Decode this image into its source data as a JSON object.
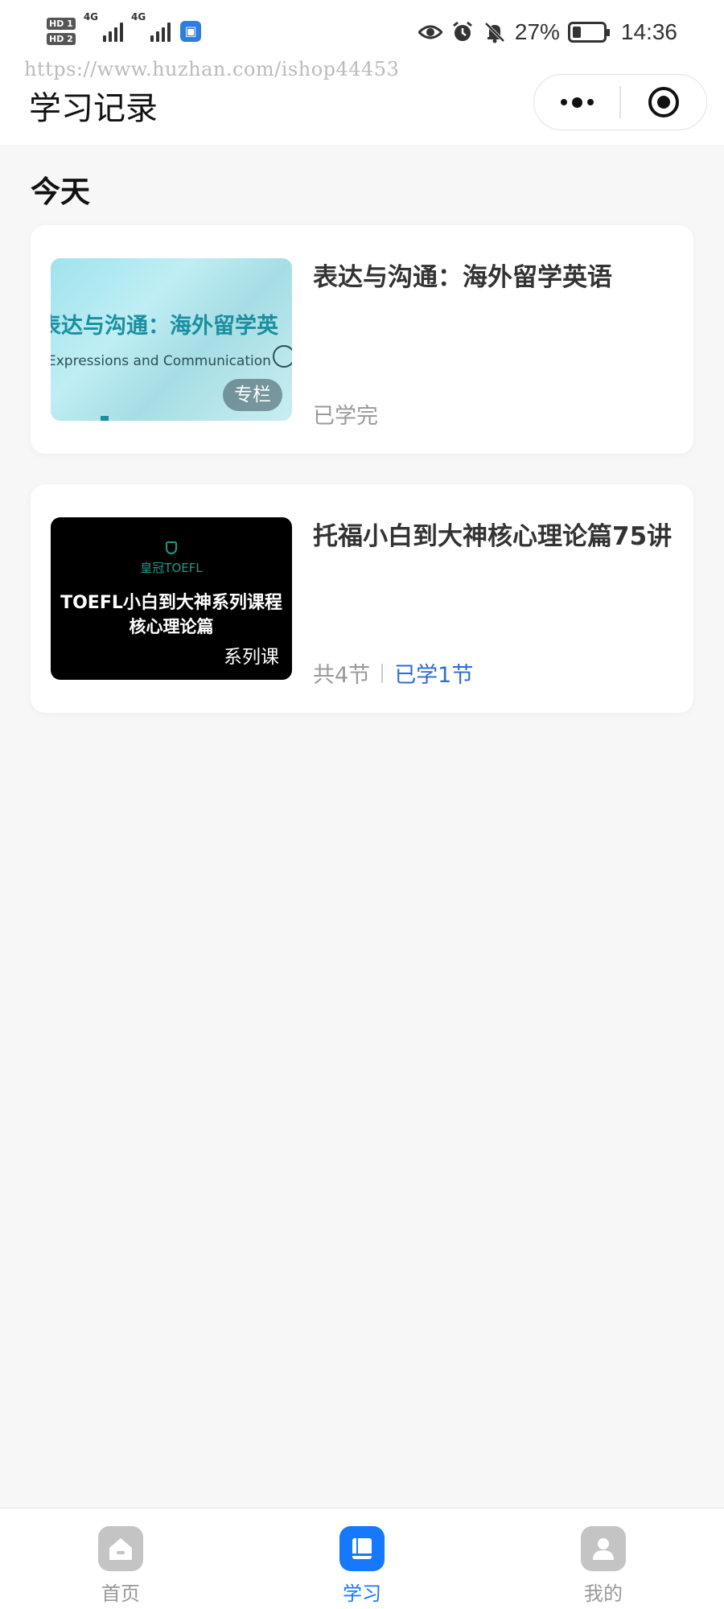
{
  "status_bar": {
    "sim1": "HD 1",
    "sim2": "HD 2",
    "net1": "4G",
    "net2": "4G",
    "battery_percent": "27%",
    "battery_level": 0.27,
    "time": "14:36",
    "icons": [
      "eye-icon",
      "alarm-icon",
      "mute-bell-icon"
    ]
  },
  "watermark": "https://www.huzhan.com/ishop44453",
  "header": {
    "title": "学习记录",
    "more_icon": "more-dots-icon",
    "close_icon": "target-circle-icon"
  },
  "section": {
    "title": "今天"
  },
  "courses": [
    {
      "thumb_title": "表达与沟通：海外留学英",
      "thumb_subtitle": "Expressions and Communication",
      "badge": "专栏",
      "title": "表达与沟通：海外留学英语",
      "status": "已学完"
    },
    {
      "thumb_logo": "皇冠TOEFL",
      "thumb_line1": "TOEFL小白到大神系列课程",
      "thumb_line2": "核心理论篇",
      "badge": "系列课",
      "title": "托福小白到大神核心理论篇75讲",
      "total": "共4节",
      "progress": "已学1节"
    }
  ],
  "tabs": [
    {
      "label": "首页",
      "icon": "home-icon",
      "active": false
    },
    {
      "label": "学习",
      "icon": "book-icon",
      "active": true
    },
    {
      "label": "我的",
      "icon": "user-icon",
      "active": false
    }
  ],
  "colors": {
    "accent": "#1677ff",
    "progress_text": "#2b6bd6",
    "background": "#f7f7f7"
  }
}
